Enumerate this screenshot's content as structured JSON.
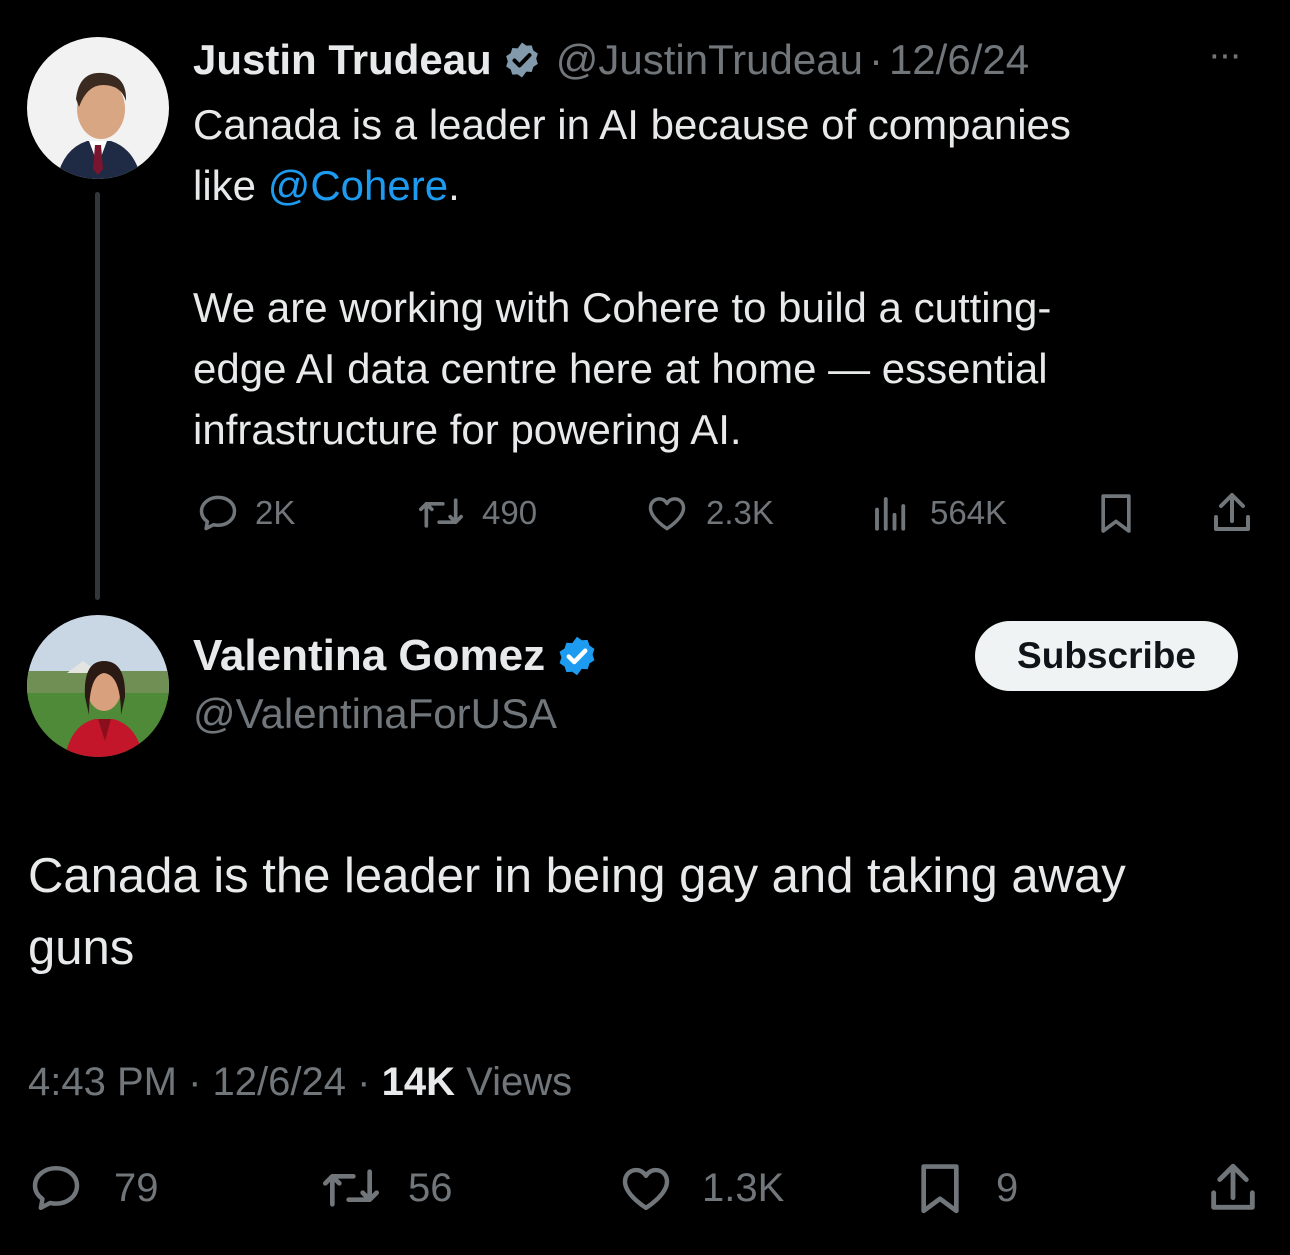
{
  "original_tweet": {
    "author_name": "Justin Trudeau",
    "handle": "@JustinTrudeau",
    "separator": "·",
    "date": "12/6/24",
    "more_label": "···",
    "text_line1_prefix": "Canada is a leader in AI because of companies",
    "text_line2_prefix": "like ",
    "mention": "@Cohere",
    "text_line2_suffix": ".",
    "text_para2_line1": "We are working with Cohere to build a cutting-",
    "text_para2_line2": "edge AI data centre here at home — essential",
    "text_para2_line3": "infrastructure for powering AI.",
    "stats": {
      "replies": "2K",
      "reposts": "490",
      "likes": "2.3K",
      "views": "564K"
    }
  },
  "reply_tweet": {
    "author_name": "Valentina Gomez",
    "handle": "@ValentinaForUSA",
    "subscribe_label": "Subscribe",
    "text_line1": "Canada is the leader in being gay and taking away",
    "text_line2": "guns",
    "time": "4:43 PM",
    "separator": "·",
    "date": "12/6/24",
    "views_count": "14K",
    "views_label": "Views",
    "stats": {
      "replies": "79",
      "reposts": "56",
      "likes": "1.3K",
      "bookmarks": "9"
    }
  },
  "colors": {
    "background": "#000000",
    "text": "#e7e9ea",
    "muted": "#71767b",
    "accent": "#1d9bf0",
    "verified_grey": "#829aab",
    "verified_blue": "#1d9bf0"
  },
  "icons": [
    "reply-icon",
    "repost-icon",
    "like-icon",
    "views-icon",
    "bookmark-icon",
    "share-icon",
    "verified-badge-icon",
    "more-icon"
  ]
}
